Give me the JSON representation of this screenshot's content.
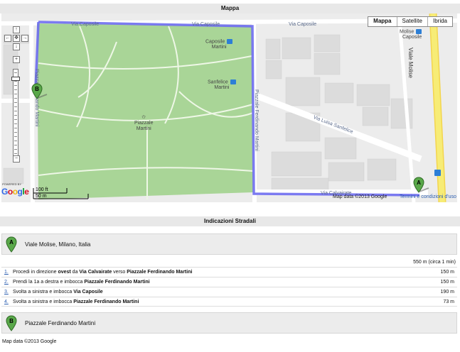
{
  "map_section": {
    "title": "Mappa",
    "map_types": [
      "Mappa",
      "Satellite",
      "Ibrida"
    ],
    "labels": {
      "via_caposile_1": "Via Caposile",
      "via_caposile_2": "Via Caposile",
      "via_caposile_3": "Via Caposile",
      "caposile_martini": [
        "Caposile",
        "Martini"
      ],
      "sanfelice_martini": [
        "Sanfelice",
        "Martini"
      ],
      "molise_caposile": [
        "Molise",
        "Caposile"
      ],
      "piazzale_martini": [
        "Piazzale",
        "Martini"
      ],
      "viale_molise": "Viale Molise",
      "via_luisa_sanfelice": "Via Luisa Sanfelice",
      "piazzale_ferdinando_martini_v": "Piazzale Ferdinando Martini",
      "piazzale_fernando_martini_left": "Piazzale Fernando Martini",
      "via_calvairate": "Via Calvairate"
    },
    "scale_ft": "100 ft",
    "scale_m": "50 m",
    "powered_by": "POWERED BY",
    "google": [
      "G",
      "o",
      "o",
      "g",
      "l",
      "e"
    ],
    "map_data": "Map data ©2013 Google",
    "terms": "Termini e condizioni d'uso",
    "marker_a": "A",
    "marker_b": "B",
    "colors": {
      "park": "#a9d597",
      "route": "#6d6cf0",
      "highway": "#f7ec76",
      "metro": "#2d7fd6"
    }
  },
  "directions": {
    "title": "Indicazioni Stradali",
    "origin": {
      "marker": "A",
      "address": "Viale Molise, Milano, Italia"
    },
    "summary": "550 m (circa 1 min)",
    "steps": [
      {
        "num": "1.",
        "parts": [
          "Procedi in direzione ",
          "ovest",
          " da ",
          "Via Calvairate",
          " verso ",
          "Piazzale Ferdinando Martini"
        ],
        "distance": "150 m"
      },
      {
        "num": "2.",
        "parts": [
          "Prendi la 1a a destra e imbocca ",
          "Piazzale Ferdinando Martini"
        ],
        "distance": "150 m"
      },
      {
        "num": "3.",
        "parts": [
          "Svolta a sinistra e imbocca ",
          "Via Caposile"
        ],
        "distance": "190 m"
      },
      {
        "num": "4.",
        "parts": [
          "Svolta a sinistra e imbocca ",
          "Piazzale Ferdinando Martini"
        ],
        "distance": "73 m"
      }
    ],
    "destination": {
      "marker": "B",
      "address": "Piazzale Ferdinando Martini"
    }
  },
  "footer": {
    "copyright": "Map data ©2013 Google"
  }
}
